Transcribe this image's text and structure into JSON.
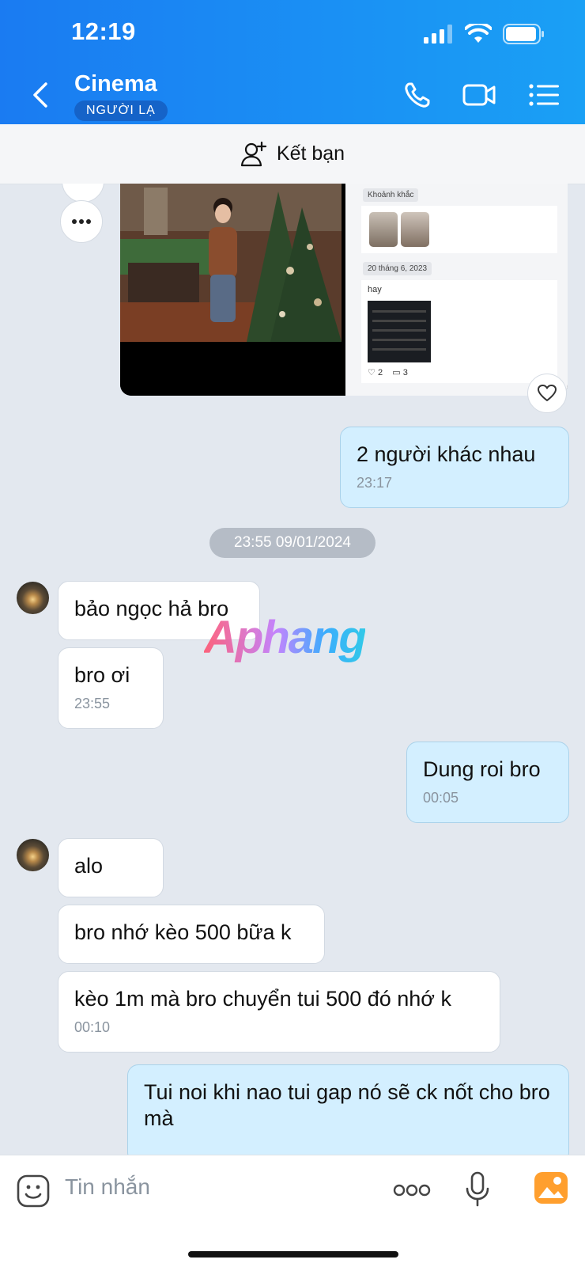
{
  "status": {
    "time": "12:19"
  },
  "header": {
    "title": "Cinema",
    "badge": "NGƯỜI LẠ"
  },
  "friend_bar": {
    "label": "Kết bạn"
  },
  "image_card": {
    "right_chip_1": "Khoảnh khắc",
    "right_chip_2": "20 tháng 6, 2023",
    "right_post_text": "hay",
    "right_likes": "2",
    "right_comments": "3"
  },
  "messages": [
    {
      "id": "m1",
      "dir": "out",
      "text": "2 người khác nhau",
      "time": "23:17"
    },
    {
      "id": "m2",
      "dir": "in",
      "text": "bảo ngọc hả bro",
      "time": ""
    },
    {
      "id": "m3",
      "dir": "in",
      "text": "bro ơi",
      "time": "23:55"
    },
    {
      "id": "m4",
      "dir": "out",
      "text": "Dung roi bro",
      "time": "00:05"
    },
    {
      "id": "m5",
      "dir": "in",
      "text": "alo",
      "time": ""
    },
    {
      "id": "m6",
      "dir": "in",
      "text": "bro nhớ kèo 500 bữa k",
      "time": ""
    },
    {
      "id": "m7",
      "dir": "in",
      "text": "kèo 1m mà bro chuyển tui 500 đó nhớ k",
      "time": "00:10"
    },
    {
      "id": "m8",
      "dir": "out",
      "text": "Tui noi khi nao tui gap nó sẽ ck nốt cho bro mà",
      "time": ""
    }
  ],
  "date_separator": "23:55 09/01/2024",
  "watermark": "Aphang",
  "input": {
    "placeholder": "Tin nhắn"
  },
  "colors": {
    "header_start": "#1a7bf2",
    "header_end": "#1aa0f5",
    "out_bubble": "#d3efff",
    "in_bubble": "#ffffff",
    "chat_bg": "#e3e8ef"
  },
  "icons": [
    "back-chevron-icon",
    "phone-icon",
    "video-call-icon",
    "menu-list-icon",
    "add-friend-icon",
    "more-dots-icon",
    "heart-icon",
    "sticker-icon",
    "more-horizontal-icon",
    "microphone-icon",
    "gallery-icon"
  ]
}
